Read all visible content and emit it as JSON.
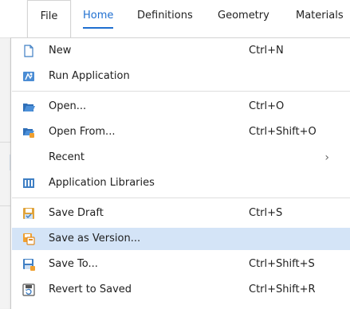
{
  "ribbon": {
    "tabs": [
      {
        "label": "File"
      },
      {
        "label": "Home"
      },
      {
        "label": "Definitions"
      },
      {
        "label": "Geometry"
      },
      {
        "label": "Materials"
      }
    ],
    "accent_color": "#1f6fd0"
  },
  "menu": {
    "items": [
      {
        "label": "New",
        "shortcut": "Ctrl+N",
        "icon": "new-document-icon"
      },
      {
        "label": "Run Application",
        "shortcut": "",
        "icon": "run-application-icon"
      },
      {
        "label": "Open...",
        "shortcut": "Ctrl+O",
        "icon": "open-folder-icon"
      },
      {
        "label": "Open From...",
        "shortcut": "Ctrl+Shift+O",
        "icon": "open-from-icon"
      },
      {
        "label": "Recent",
        "shortcut": "",
        "icon": "",
        "submenu": true
      },
      {
        "label": "Application Libraries",
        "shortcut": "",
        "icon": "application-libraries-icon"
      },
      {
        "label": "Save Draft",
        "shortcut": "Ctrl+S",
        "icon": "save-draft-icon"
      },
      {
        "label": "Save as Version...",
        "shortcut": "",
        "icon": "save-as-version-icon",
        "highlighted": true
      },
      {
        "label": "Save To...",
        "shortcut": "Ctrl+Shift+S",
        "icon": "save-to-icon"
      },
      {
        "label": "Revert to Saved",
        "shortcut": "Ctrl+Shift+R",
        "icon": "revert-to-saved-icon"
      }
    ],
    "highlight_color": "#d4e4f7"
  }
}
